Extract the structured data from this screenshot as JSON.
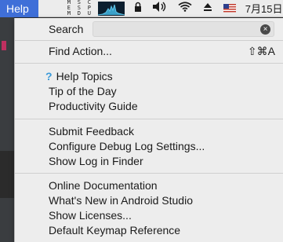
{
  "menubar": {
    "active_menu": "Help",
    "monitors": [
      {
        "name": "memory-monitor",
        "text": "M\nE\nM"
      },
      {
        "name": "disk-monitor",
        "text": "S\nS\nD"
      },
      {
        "name": "cpu-monitor",
        "text": "C\nP\nU"
      }
    ],
    "tray_icons": [
      "lock-icon",
      "volume-icon",
      "wifi-icon",
      "eject-icon",
      "us-flag-icon"
    ],
    "clock": "7月15日"
  },
  "menu": {
    "search": {
      "label": "Search",
      "value": "",
      "clear_glyph": "×"
    },
    "groups": [
      [
        {
          "label": "Find Action...",
          "shortcut": "⇧⌘A"
        }
      ],
      [
        {
          "label": "Help Topics",
          "icon": "question-mark-icon"
        },
        {
          "label": "Tip of the Day"
        },
        {
          "label": "Productivity Guide"
        }
      ],
      [
        {
          "label": "Submit Feedback"
        },
        {
          "label": "Configure Debug Log Settings..."
        },
        {
          "label": "Show Log in Finder"
        }
      ],
      [
        {
          "label": "Online Documentation"
        },
        {
          "label": "What's New in Android Studio"
        },
        {
          "label": "Show Licenses..."
        },
        {
          "label": "Default Keymap Reference"
        }
      ]
    ]
  },
  "colors": {
    "menubar_bg": "#ececec",
    "menu_highlight": "#3f6fd8",
    "menu_bg": "#ededed",
    "help_icon": "#3a9ad9"
  }
}
